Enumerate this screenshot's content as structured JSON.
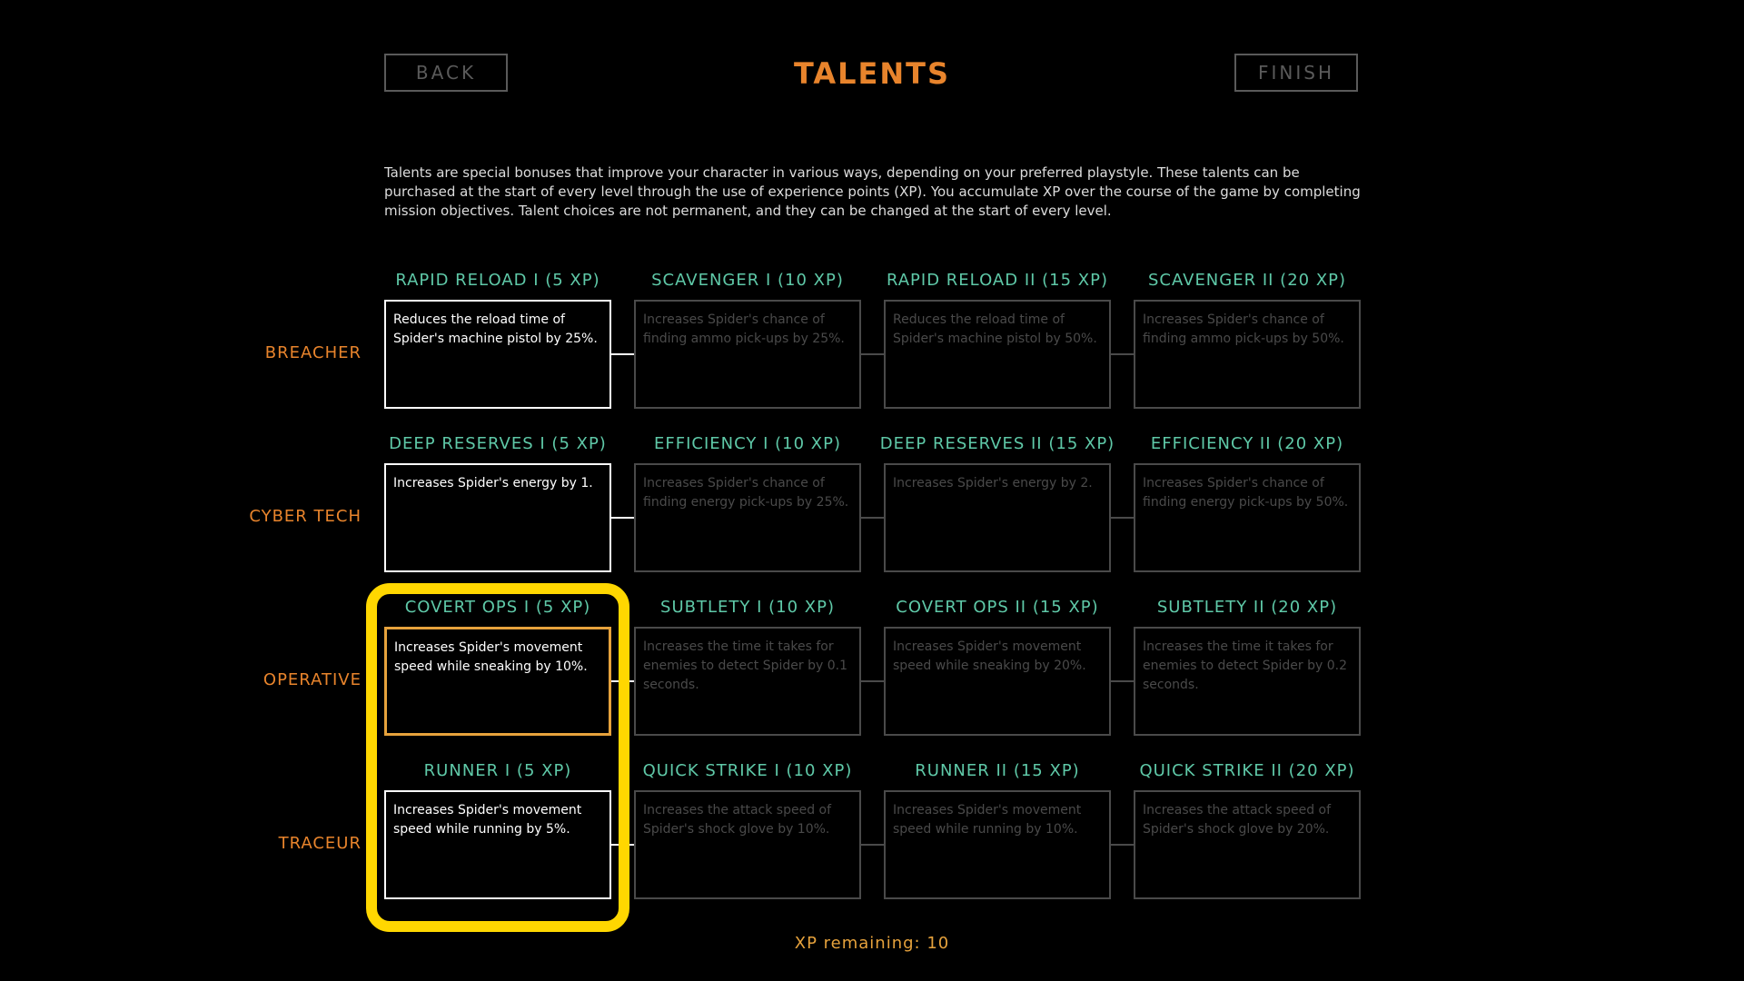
{
  "header": {
    "back_label": "BACK",
    "title": "TALENTS",
    "finish_label": "FINISH"
  },
  "description": "Talents are special bonuses that improve your character in various ways, depending on your preferred playstyle. These talents can be purchased at the start of every level through the use of experience points (XP). You accumulate XP over the course of the game by completing mission objectives. Talent choices are not permanent, and they can be changed at the start of every level.",
  "colors": {
    "accent_orange": "#e8842c",
    "talent_title_teal": "#5fc9a8",
    "selected_border": "#e6a23c",
    "highlight_yellow": "#ffd700",
    "xp_text": "#e6a23c"
  },
  "rows": [
    {
      "label": "BREACHER",
      "talents": [
        {
          "title": "RAPID RELOAD I (5 XP)",
          "description": "Reduces the reload time of Spider's machine pistol by 25%.",
          "state": "active"
        },
        {
          "title": "SCAVENGER I (10 XP)",
          "description": "Increases Spider's chance of finding ammo pick-ups by 25%.",
          "state": "locked"
        },
        {
          "title": "RAPID RELOAD II (15 XP)",
          "description": "Reduces the reload time of Spider's machine pistol by 50%.",
          "state": "locked"
        },
        {
          "title": "SCAVENGER II (20 XP)",
          "description": "Increases Spider's chance of finding ammo pick-ups by 50%.",
          "state": "locked"
        }
      ]
    },
    {
      "label": "CYBER TECH",
      "talents": [
        {
          "title": "DEEP RESERVES I (5 XP)",
          "description": "Increases Spider's energy by 1.",
          "state": "active"
        },
        {
          "title": "EFFICIENCY I (10 XP)",
          "description": "Increases Spider's chance of finding energy pick-ups by 25%.",
          "state": "locked"
        },
        {
          "title": "DEEP RESERVES II (15 XP)",
          "description": "Increases Spider's energy by 2.",
          "state": "locked"
        },
        {
          "title": "EFFICIENCY II (20 XP)",
          "description": "Increases Spider's chance of finding energy pick-ups by 50%.",
          "state": "locked"
        }
      ]
    },
    {
      "label": "OPERATIVE",
      "talents": [
        {
          "title": "COVERT OPS I (5 XP)",
          "description": "Increases Spider's movement speed while sneaking by 10%.",
          "state": "selected"
        },
        {
          "title": "SUBTLETY I (10 XP)",
          "description": "Increases the time it takes for enemies to detect Spider by 0.1 seconds.",
          "state": "locked"
        },
        {
          "title": "COVERT OPS II (15 XP)",
          "description": "Increases Spider's movement speed while sneaking by 20%.",
          "state": "locked"
        },
        {
          "title": "SUBTLETY II (20 XP)",
          "description": "Increases the time it takes for enemies to detect Spider by 0.2 seconds.",
          "state": "locked"
        }
      ]
    },
    {
      "label": "TRACEUR",
      "talents": [
        {
          "title": "RUNNER I (5 XP)",
          "description": "Increases Spider's movement speed while running by 5%.",
          "state": "active"
        },
        {
          "title": "QUICK STRIKE I (10 XP)",
          "description": "Increases the attack speed of Spider's shock glove by 10%.",
          "state": "locked"
        },
        {
          "title": "RUNNER II (15 XP)",
          "description": "Increases Spider's movement speed while running by 10%.",
          "state": "locked"
        },
        {
          "title": "QUICK STRIKE II (20 XP)",
          "description": "Increases the attack speed of Spider's shock glove by 20%.",
          "state": "locked"
        }
      ]
    }
  ],
  "footer": {
    "xp_remaining": "XP remaining: 10"
  }
}
